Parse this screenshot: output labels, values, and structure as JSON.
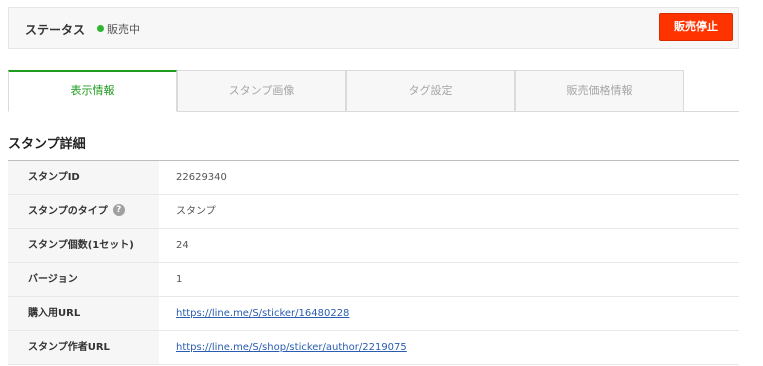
{
  "status": {
    "label": "ステータス",
    "value": "販売中",
    "dot_color": "#2fb52f",
    "stop_button_label": "販売停止"
  },
  "tabs": [
    {
      "label": "表示情報",
      "active": true
    },
    {
      "label": "スタンプ画像",
      "active": false
    },
    {
      "label": "タグ設定",
      "active": false
    },
    {
      "label": "販売価格情報",
      "active": false
    }
  ],
  "section_title": "スタンプ詳細",
  "details": [
    {
      "label": "スタンプID",
      "value": "22629340"
    },
    {
      "label": "スタンプのタイプ",
      "value": "スタンプ",
      "help_icon": "question-icon",
      "help_glyph": "?"
    },
    {
      "label": "スタンプ個数(1セット)",
      "value": "24"
    },
    {
      "label": "バージョン",
      "value": "1"
    },
    {
      "label": "購入用URL",
      "value": "https://line.me/S/sticker/16480228"
    },
    {
      "label": "スタンプ作者URL",
      "value": "https://line.me/S/shop/sticker/author/2219075"
    }
  ],
  "colors": {
    "accent_green": "#1f9d1f",
    "stop_red": "#ff3300",
    "link_blue": "#2a5db0"
  }
}
